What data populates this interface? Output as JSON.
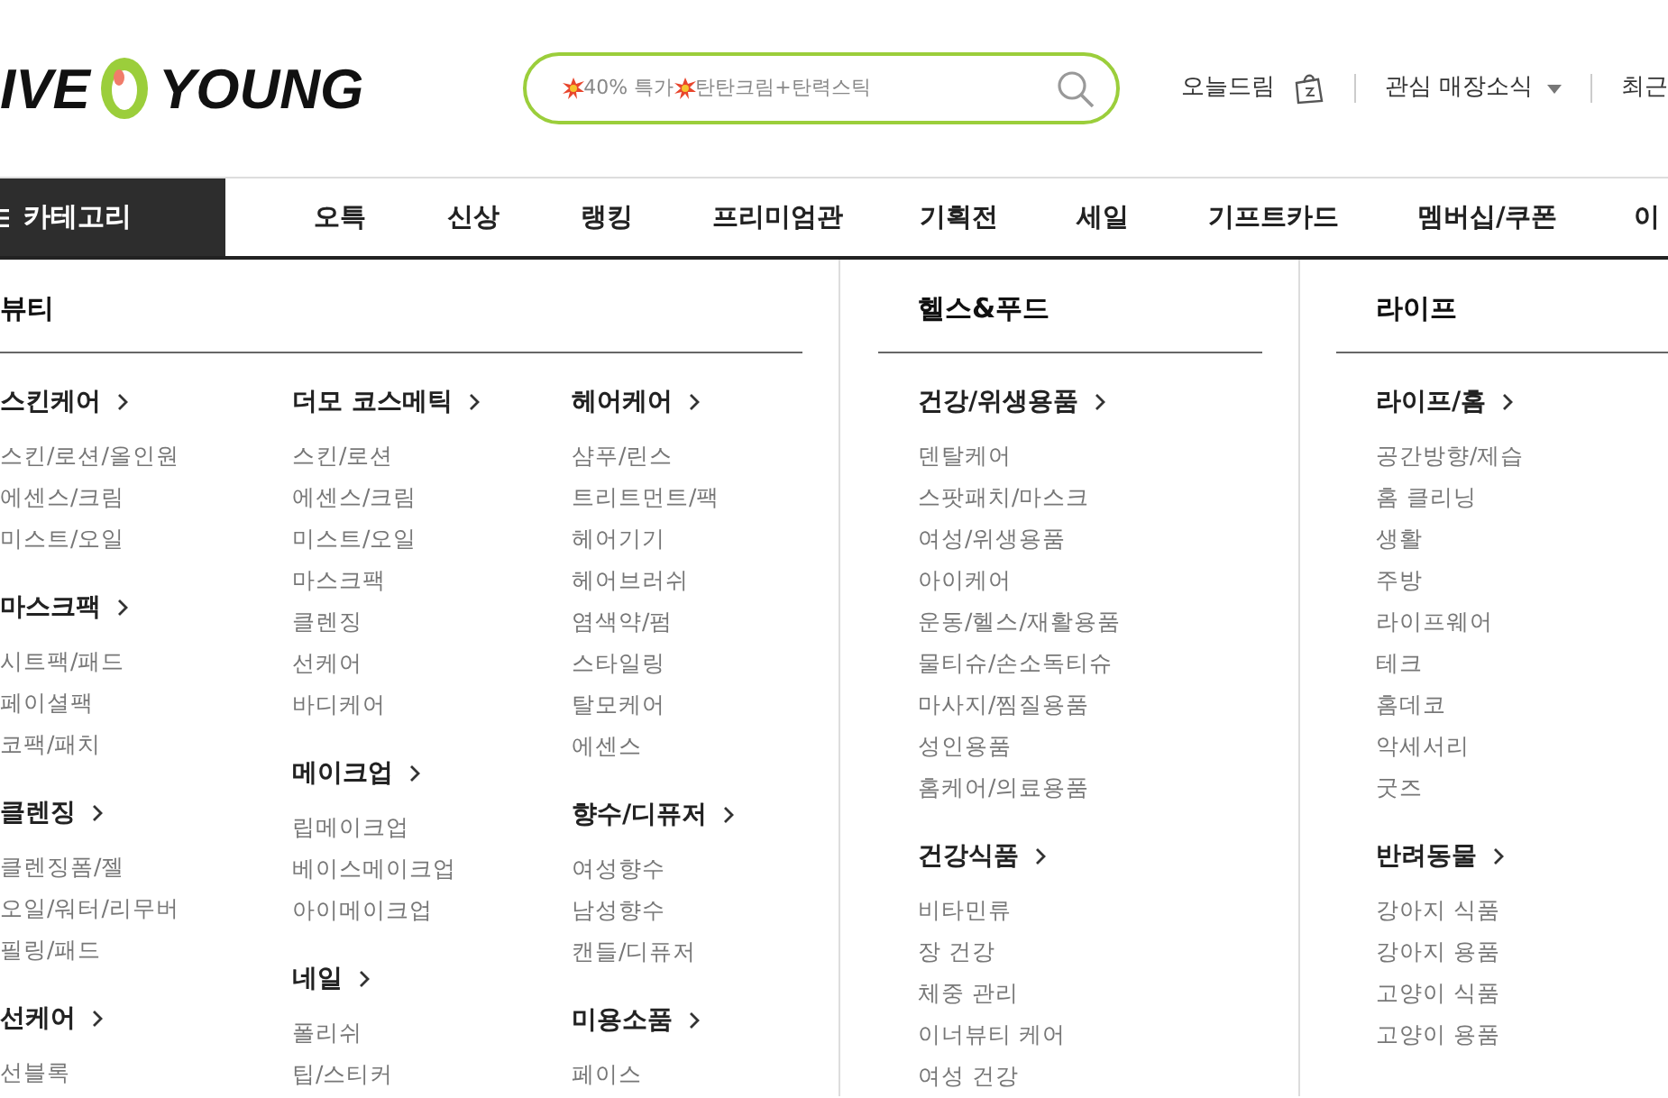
{
  "header": {
    "logo": {
      "left": "IVE",
      "right": "YOUNG"
    },
    "search": {
      "promo_text": [
        "40% 특가",
        "탄탄크림+탄력스틱"
      ]
    },
    "links": [
      {
        "label": "오늘드림",
        "kind": "bag"
      },
      {
        "label": "관심 매장소식",
        "kind": "dropdown"
      },
      {
        "label": "최근",
        "kind": "plain"
      }
    ]
  },
  "nav": {
    "category_button": "카테고리",
    "items": [
      "오특",
      "신상",
      "랭킹",
      "프리미엄관",
      "기획전",
      "세일",
      "기프트카드",
      "멤버십/쿠폰",
      "이"
    ]
  },
  "menu": [
    {
      "title": "뷰티",
      "columns": [
        [
          {
            "title": "스킨케어",
            "items": [
              "스킨/로션/올인원",
              "에센스/크림",
              "미스트/오일"
            ]
          },
          {
            "title": "마스크팩",
            "items": [
              "시트팩/패드",
              "페이셜팩",
              "코팩/패치"
            ]
          },
          {
            "title": "클렌징",
            "items": [
              "클렌징폼/젤",
              "오일/워터/리무버",
              "필링/패드"
            ]
          },
          {
            "title": "선케어",
            "items": [
              "선블록"
            ]
          }
        ],
        [
          {
            "title": "더모 코스메틱",
            "items": [
              "스킨/로션",
              "에센스/크림",
              "미스트/오일",
              "마스크팩",
              "클렌징",
              "선케어",
              "바디케어"
            ]
          },
          {
            "title": "메이크업",
            "items": [
              "립메이크업",
              "베이스메이크업",
              "아이메이크업"
            ]
          },
          {
            "title": "네일",
            "items": [
              "폴리쉬",
              "팁/스티커"
            ]
          }
        ],
        [
          {
            "title": "헤어케어",
            "items": [
              "샴푸/린스",
              "트리트먼트/팩",
              "헤어기기",
              "헤어브러쉬",
              "염색약/펌",
              "스타일링",
              "탈모케어",
              "에센스"
            ]
          },
          {
            "title": "향수/디퓨저",
            "items": [
              "여성향수",
              "남성향수",
              "캔들/디퓨저"
            ]
          },
          {
            "title": "미용소품",
            "items": [
              "페이스"
            ]
          }
        ]
      ]
    },
    {
      "title": "헬스&푸드",
      "columns": [
        [
          {
            "title": "건강/위생용품",
            "items": [
              "덴탈케어",
              "스팟패치/마스크",
              "여성/위생용품",
              "아이케어",
              "운동/헬스/재활용품",
              "물티슈/손소독티슈",
              "마사지/찜질용품",
              "성인용품",
              "홈케어/의료용품"
            ]
          },
          {
            "title": "건강식품",
            "items": [
              "비타민류",
              "장 건강",
              "체중 관리",
              "이너뷰티 케어",
              "여성 건강"
            ]
          }
        ]
      ]
    },
    {
      "title": "라이프",
      "columns": [
        [
          {
            "title": "라이프/홈",
            "items": [
              "공간방향/제습",
              "홈 클리닝",
              "생활",
              "주방",
              "라이프웨어",
              "테크",
              "홈데코",
              "악세서리",
              "굿즈"
            ]
          },
          {
            "title": "반려동물",
            "items": [
              "강아지 식품",
              "강아지 용품",
              "고양이 식품",
              "고양이 용품"
            ]
          }
        ]
      ]
    }
  ]
}
